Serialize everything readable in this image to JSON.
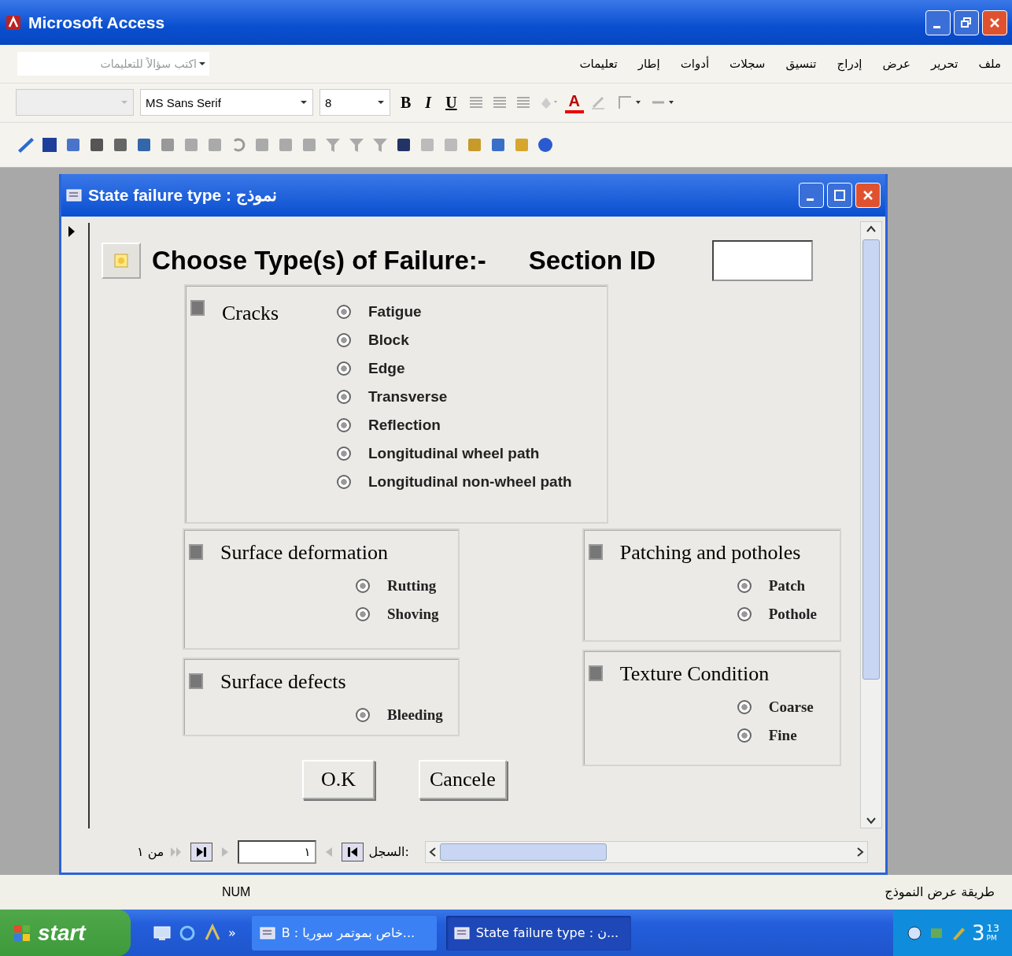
{
  "window": {
    "title": "Microsoft Access"
  },
  "menu": {
    "items": [
      "ملف",
      "تحرير",
      "عرض",
      "إدراج",
      "تنسيق",
      "سجلات",
      "أدوات",
      "إطار",
      "تعليمات"
    ],
    "help_box": {
      "placeholder": "اكتب سؤالاً للتعليمات"
    }
  },
  "format_toolbar": {
    "font": "MS Sans Serif",
    "size": "8",
    "bold": "B",
    "italic": "I",
    "underline": "U",
    "font_color": "A"
  },
  "form_window": {
    "title": "State failure type : نموذج",
    "heading": "Choose Type(s) of Failure:-",
    "section_label": "Section ID",
    "main_group": {
      "title": "Cracks",
      "disabled": true,
      "options": [
        {
          "label": "Fatigue",
          "disabled": true
        },
        {
          "label": "Block",
          "disabled": true
        },
        {
          "label": "Edge",
          "disabled": true
        },
        {
          "label": "Transverse",
          "disabled": true
        },
        {
          "label": "Reflection",
          "disabled": true
        },
        {
          "label": "Longitudinal wheel path",
          "disabled": true
        },
        {
          "label": "Longitudinal non-wheel path",
          "disabled": true
        }
      ]
    },
    "groups": [
      {
        "title": "Patching and potholes",
        "disabled": true,
        "options": [
          {
            "label": "Patch",
            "disabled": true
          },
          {
            "label": "Pothole",
            "disabled": true
          }
        ]
      },
      {
        "title": "Surface deformation",
        "disabled": true,
        "options": [
          {
            "label": "Rutting",
            "disabled": true
          },
          {
            "label": "Shoving",
            "disabled": true
          }
        ]
      },
      {
        "title": "Texture Condition",
        "disabled": true,
        "options": [
          {
            "label": "Coarse",
            "disabled": true
          },
          {
            "label": "Fine",
            "disabled": true
          }
        ]
      },
      {
        "title": "Surface defects",
        "disabled": true,
        "options": [
          {
            "label": "Bleeding",
            "disabled": true
          }
        ]
      }
    ],
    "buttons": [
      "Cancele",
      "O.K"
    ],
    "navigation": {
      "label": "السجل:",
      "record": "١",
      "total": "من ١"
    }
  },
  "status_bar": {
    "view": "طريقة عرض النموذج",
    "num": "NUM"
  },
  "taskbar": {
    "start": "start",
    "more": "»",
    "tasks": [
      {
        "label": "State failure type : ن...",
        "selected": true
      },
      {
        "label": "B : خاص بموتمر سوريا...",
        "selected": false
      }
    ],
    "clock": {
      "hour": "3",
      "minute": "13",
      "ampm": "PM"
    }
  }
}
